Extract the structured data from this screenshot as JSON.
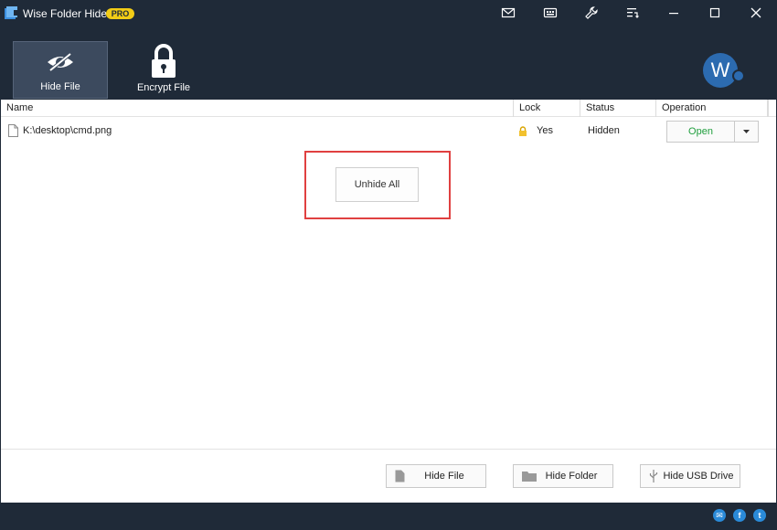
{
  "titlebar": {
    "app_title": "Wise Folder Hider",
    "badge": "PRO",
    "icons": [
      "mail-icon",
      "feedback-icon",
      "settings-icon",
      "menu-icon"
    ],
    "window_controls": [
      "minimize-icon",
      "maximize-icon",
      "close-icon"
    ]
  },
  "toolbar": {
    "hide_file_label": "Hide File",
    "encrypt_file_label": "Encrypt File",
    "avatar_letter": "W"
  },
  "table": {
    "columns": [
      "Name",
      "Lock",
      "Status",
      "Operation"
    ],
    "rows": [
      {
        "name": "K:\\desktop\\cmd.png",
        "lock": "Yes",
        "status": "Hidden",
        "operation": "Open"
      }
    ]
  },
  "actions": {
    "unhide_all_label": "Unhide All"
  },
  "bottom_buttons": {
    "hide_file": "Hide File",
    "hide_folder": "Hide Folder",
    "hide_usb": "Hide USB Drive"
  },
  "footer": {
    "social": [
      "email-icon",
      "facebook-icon",
      "twitter-icon"
    ]
  },
  "colors": {
    "background": "#1f2a38",
    "badge": "#f2cc16",
    "accent": "#2c6bb0",
    "open_text": "#1f9e3d",
    "highlight": "#e04040"
  }
}
